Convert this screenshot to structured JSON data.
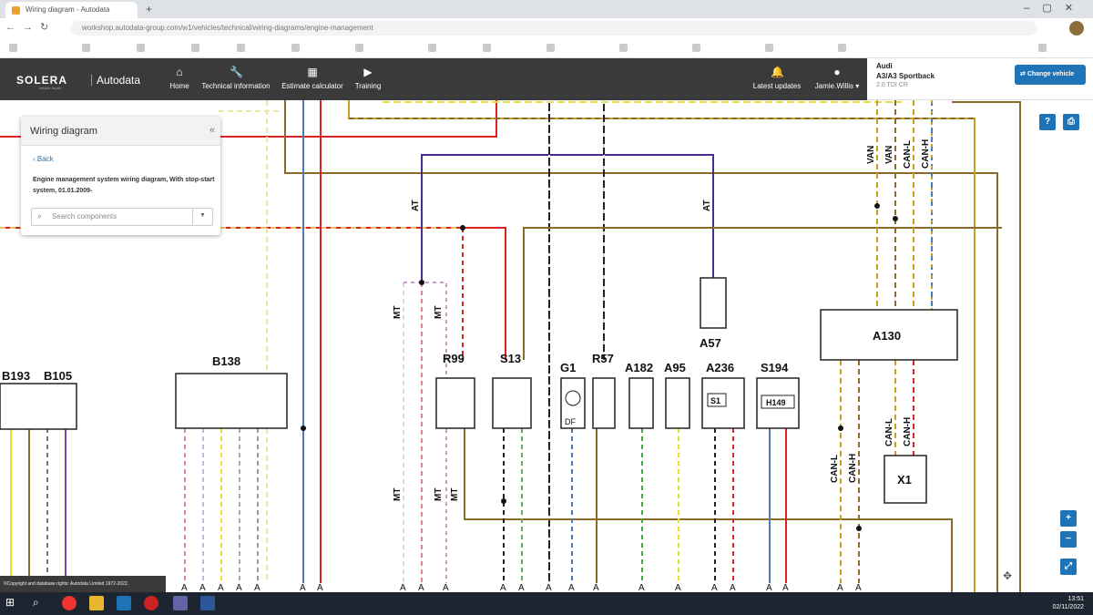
{
  "browser": {
    "tab_title": "Wiring diagram - Autodata",
    "new_tab_icon": "plus-icon",
    "address": "workshop.autodata-group.com/w1/vehicles/technical/wiring-diagrams/engine-management",
    "bookmarks": [
      "",
      "",
      "",
      "",
      "",
      "",
      "",
      "",
      "",
      "",
      "",
      "",
      "",
      "",
      ""
    ]
  },
  "app": {
    "brand": "SOLERA",
    "brand_sub": "vehicle repair",
    "product": "Autodata",
    "nav": [
      {
        "label": "Home",
        "icon": "home-icon"
      },
      {
        "label": "Technical information",
        "icon": "wrench-icon"
      },
      {
        "label": "Estimate calculator",
        "icon": "calculator-icon"
      },
      {
        "label": "Training",
        "icon": "play-icon"
      }
    ],
    "latest_updates": "Latest updates",
    "user": "Jamie.Willis",
    "vehicle": {
      "make": "Audi",
      "model": "A3/A3 Sportback",
      "engine": "2.0 TDI CR",
      "change_label": "Change vehicle"
    }
  },
  "sidepanel": {
    "title": "Wiring diagram",
    "back": "Back",
    "description": "Engine management system wiring diagram, With stop-start system, 01.01.2009-",
    "search_placeholder": "Search components"
  },
  "diagram": {
    "components": [
      {
        "id": "B193"
      },
      {
        "id": "B105"
      },
      {
        "id": "B138"
      },
      {
        "id": "R99"
      },
      {
        "id": "S13"
      },
      {
        "id": "G1"
      },
      {
        "id": "R57"
      },
      {
        "id": "A182"
      },
      {
        "id": "A95"
      },
      {
        "id": "A236"
      },
      {
        "id": "S194"
      },
      {
        "id": "A57"
      },
      {
        "id": "A130"
      },
      {
        "id": "X1"
      }
    ],
    "labels": {
      "at": "AT",
      "mt": "MT",
      "van": "VAN",
      "can_l": "CAN-L",
      "can_h": "CAN-H",
      "h149": "H149",
      "s1": "S1",
      "df": "DF"
    }
  },
  "copyright": "©Copyright and database rights: Autodata Limited 1972-2022.",
  "taskbar": {
    "time": "13:51",
    "date": "02/11/2022"
  }
}
